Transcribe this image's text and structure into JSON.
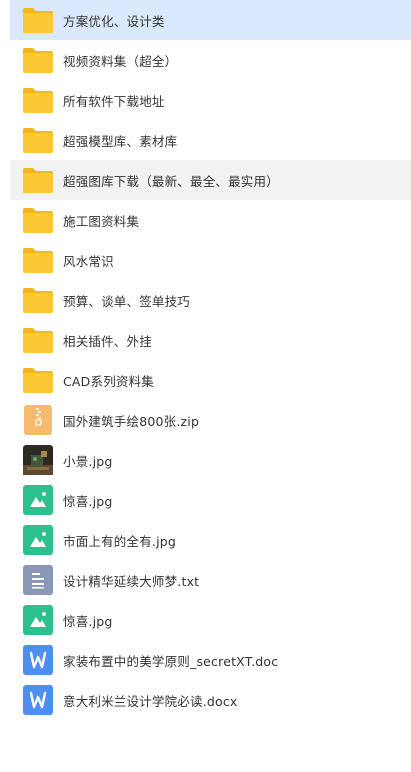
{
  "files": [
    {
      "name": "方案优化、设计类",
      "kind": "folder",
      "state": "selected"
    },
    {
      "name": "视频资料集（超全）",
      "kind": "folder",
      "state": ""
    },
    {
      "name": "所有软件下载地址",
      "kind": "folder",
      "state": ""
    },
    {
      "name": "超强模型库、素材库",
      "kind": "folder",
      "state": ""
    },
    {
      "name": "超强图库下载（最新、最全、最实用）",
      "kind": "folder",
      "state": "hover"
    },
    {
      "name": "施工图资料集",
      "kind": "folder",
      "state": ""
    },
    {
      "name": "风水常识",
      "kind": "folder",
      "state": ""
    },
    {
      "name": "预算、谈单、签单技巧",
      "kind": "folder",
      "state": ""
    },
    {
      "name": "相关插件、外挂",
      "kind": "folder",
      "state": ""
    },
    {
      "name": "CAD系列资料集",
      "kind": "folder",
      "state": ""
    },
    {
      "name": "国外建筑手绘800张.zip",
      "kind": "zip",
      "state": ""
    },
    {
      "name": "小景.jpg",
      "kind": "photo",
      "state": ""
    },
    {
      "name": "惊喜.jpg",
      "kind": "image",
      "state": ""
    },
    {
      "name": "市面上有的全有.jpg",
      "kind": "image",
      "state": ""
    },
    {
      "name": "设计精华延续大师梦.txt",
      "kind": "txt",
      "state": ""
    },
    {
      "name": "惊喜.jpg",
      "kind": "image",
      "state": ""
    },
    {
      "name": "家装布置中的美学原则_secretXT.doc",
      "kind": "doc",
      "state": ""
    },
    {
      "name": "意大利米兰设计学院必读.docx",
      "kind": "doc",
      "state": ""
    }
  ],
  "icons": {
    "folder": "folder-icon",
    "zip": "zip-file-icon",
    "photo": "photo-thumbnail-icon",
    "image": "image-file-icon",
    "txt": "text-file-icon",
    "doc": "word-doc-icon"
  },
  "colors": {
    "folder": "#fcc934",
    "folder_back": "#f4b71b",
    "zip": "#f7b96b",
    "image": "#2bc08c",
    "txt": "#8a97b5",
    "doc": "#4c8ff0",
    "selected_bg": "#d9e8fb",
    "hover_bg": "#f2f2f2"
  }
}
